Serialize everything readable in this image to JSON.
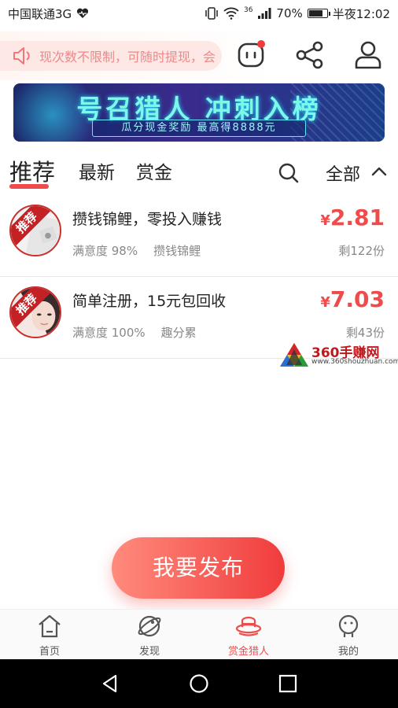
{
  "status_bar": {
    "carrier": "中国联通3G",
    "network": "36",
    "battery": "70%",
    "time": "半夜12:02"
  },
  "header": {
    "notice_text": "现次数不限制，可随时提现，会"
  },
  "banner": {
    "title": "号召猎人  冲刺入榜",
    "subtitle": "瓜分现金奖励  最高得8888元"
  },
  "tabs": [
    {
      "label": "推荐"
    },
    {
      "label": "最新"
    },
    {
      "label": "赏金"
    }
  ],
  "filter_label": "全部",
  "tasks": [
    {
      "title": "攒钱锦鲤，零投入赚钱",
      "satisfaction": "满意度 98%",
      "tag": "攒钱锦鲤",
      "currency": "¥",
      "price": "2.81",
      "remaining": "剩122份",
      "badge": "推荐"
    },
    {
      "title": "简单注册，15元包回收",
      "satisfaction": "满意度 100%",
      "tag": "趣分累",
      "currency": "¥",
      "price": "7.03",
      "remaining": "剩43份",
      "badge": "推荐"
    }
  ],
  "watermark": {
    "name": "360手赚网",
    "url": "www.360shouzhuan.com"
  },
  "publish_label": "我要发布",
  "bottom_nav": [
    {
      "label": "首页",
      "icon": "home-icon"
    },
    {
      "label": "发现",
      "icon": "planet-icon"
    },
    {
      "label": "赏金猎人",
      "icon": "hunter-hat-icon"
    },
    {
      "label": "我的",
      "icon": "profile-icon"
    }
  ],
  "colors": {
    "accent": "#ef4b4b",
    "banner_bg": "#2a2a80"
  }
}
